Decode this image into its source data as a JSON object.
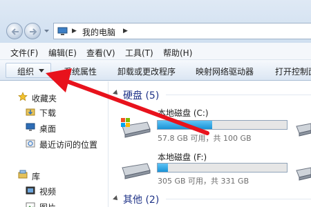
{
  "address": {
    "location": "我的电脑"
  },
  "menubar": {
    "items": [
      "文件(F)",
      "编辑(E)",
      "查看(V)",
      "工具(T)",
      "帮助(H)"
    ]
  },
  "toolbar": {
    "organize": "组织",
    "items": [
      "系统属性",
      "卸载或更改程序",
      "映射网络驱动器",
      "打开控制面"
    ]
  },
  "nav": {
    "favorites": "收藏夹",
    "favorites_items": [
      "下载",
      "桌面",
      "最近访问的位置"
    ],
    "library": "库",
    "library_items": [
      "视频",
      "图片"
    ]
  },
  "content": {
    "hard_disks_header": "硬盘 (5)",
    "other_header": "其他 (2)",
    "drives": [
      {
        "name": "本地磁盘 (C:)",
        "free_text": "57.8 GB 可用，共 100 GB",
        "used_fraction": 0.42
      },
      {
        "name": "本地磁盘 (F:)",
        "free_text": "305 GB 可用，共 331 GB",
        "used_fraction": 0.08
      }
    ]
  },
  "colors": {
    "arrow": "#e8121c",
    "drive_bar": "#26a0da",
    "group_header": "#1e3287"
  }
}
